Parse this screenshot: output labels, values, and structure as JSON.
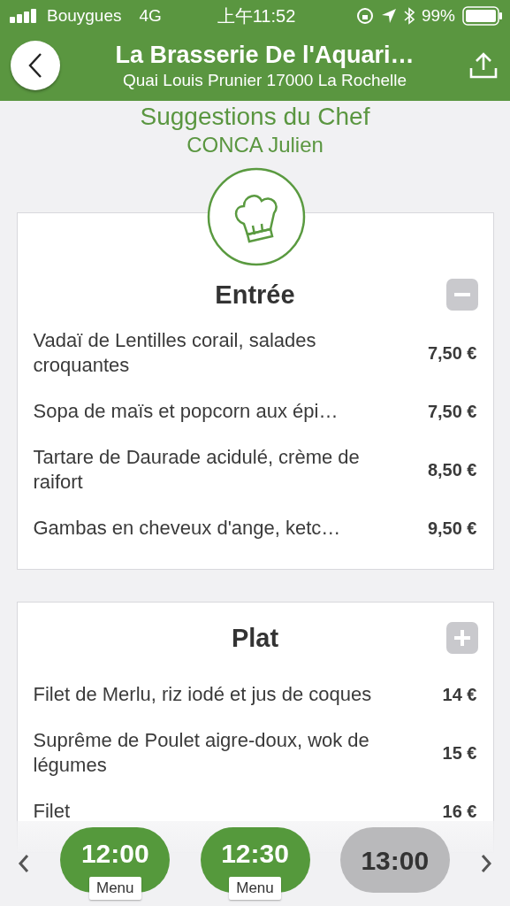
{
  "status_bar": {
    "carrier": "Bouygues",
    "network": "4G",
    "time": "上午11:52",
    "battery": "99%"
  },
  "header": {
    "title": "La Brasserie De l'Aquari…",
    "subtitle": "Quai Louis Prunier 17000 La Rochelle"
  },
  "heading": "Suggestions du Chef",
  "chef": "CONCA Julien",
  "sections": [
    {
      "title": "Entrée",
      "expanded": true,
      "items": [
        {
          "name": "Vadaï de Lentilles corail, salades croquantes",
          "price": "7,50 €"
        },
        {
          "name": "Sopa de maïs et popcorn aux épi…",
          "price": "7,50 €"
        },
        {
          "name": "Tartare de Daurade acidulé, crème de raifort",
          "price": "8,50 €"
        },
        {
          "name": "Gambas en cheveux d'ange, ketc…",
          "price": "9,50 €"
        }
      ]
    },
    {
      "title": "Plat",
      "expanded": false,
      "items": [
        {
          "name": "Filet de Merlu, riz iodé et jus de coques",
          "price": "14 €"
        },
        {
          "name": "Suprême de Poulet aigre-doux, wok de légumes",
          "price": "15 €"
        },
        {
          "name": "Filet",
          "price": "16 €"
        }
      ]
    }
  ],
  "slots": [
    {
      "time": "12:00",
      "label": "Menu",
      "available": true
    },
    {
      "time": "12:30",
      "label": "Menu",
      "available": true
    },
    {
      "time": "13:00",
      "available": false
    }
  ]
}
